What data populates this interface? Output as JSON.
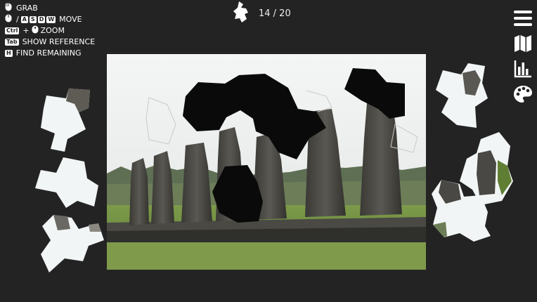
{
  "controls": {
    "grab": {
      "label": "GRAB",
      "icon": "mouse-icon"
    },
    "move": {
      "keys": [
        "A",
        "S",
        "D",
        "W"
      ],
      "separator": "/",
      "label": "MOVE",
      "icon": "mouse-icon"
    },
    "zoom": {
      "key": "Ctrl",
      "plus": "+",
      "label": "ZOOM",
      "icon": "mouse-scroll-icon"
    },
    "reference": {
      "key": "Tab",
      "label": "SHOW REFERENCE"
    },
    "find": {
      "key": "H",
      "label": "FIND REMAINING"
    }
  },
  "progress": {
    "text": "14 / 20",
    "placed": 14,
    "total": 20,
    "icon": "puzzle-piece-icon"
  },
  "toolbar": [
    "menu-icon",
    "map-icon",
    "stats-icon",
    "palette-icon"
  ],
  "colors": {
    "background": "#232323",
    "sky": "#eef0f0",
    "grass": "#6b8a3e",
    "statue": "#4a4844",
    "hole": "#0a0a0a"
  }
}
